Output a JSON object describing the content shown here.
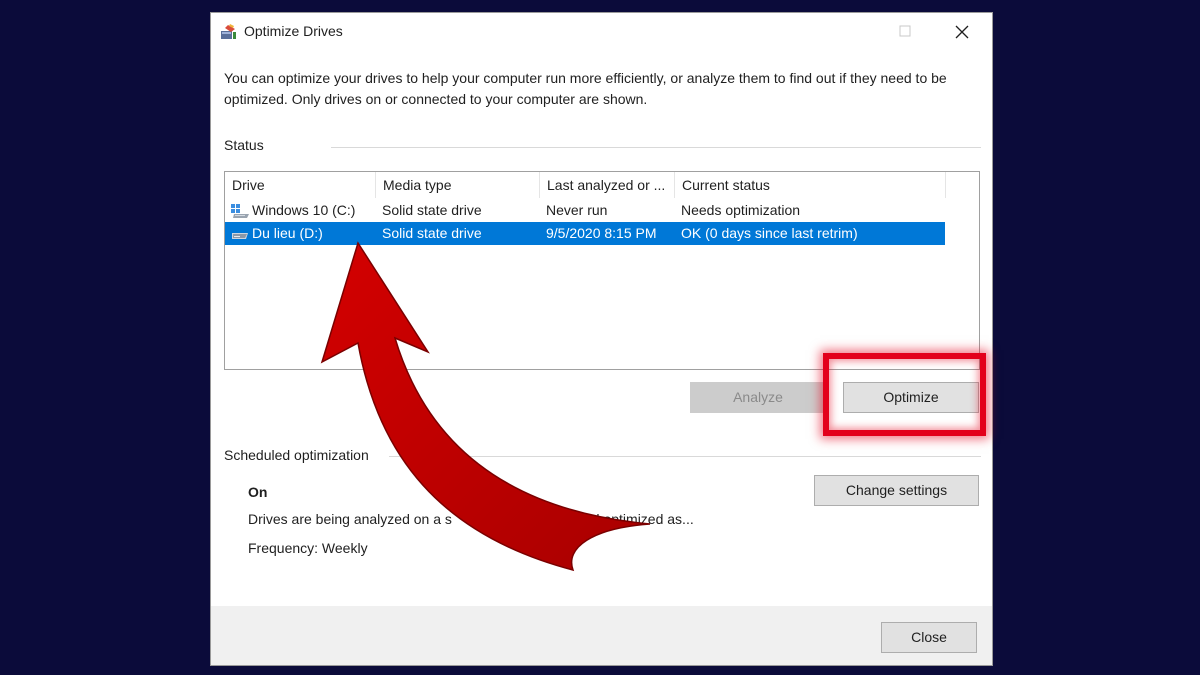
{
  "window": {
    "title": "Optimize Drives",
    "description": "You can optimize your drives to help your computer run more efficiently, or analyze them to find out if they need to be optimized. Only drives on or connected to your computer are shown."
  },
  "status": {
    "label": "Status",
    "columns": [
      "Drive",
      "Media type",
      "Last analyzed or ...",
      "Current status"
    ],
    "rows": [
      {
        "drive": "Windows 10 (C:)",
        "media": "Solid state drive",
        "last": "Never run",
        "status": "Needs optimization",
        "icon": "windows-drive-icon",
        "selected": false
      },
      {
        "drive": "Du lieu (D:)",
        "media": "Solid state drive",
        "last": "9/5/2020 8:15 PM",
        "status": "OK (0 days since last retrim)",
        "icon": "drive-icon",
        "selected": true
      }
    ]
  },
  "buttons": {
    "analyze": "Analyze",
    "optimize": "Optimize",
    "change_settings": "Change settings",
    "close": "Close"
  },
  "scheduled": {
    "label": "Scheduled optimization",
    "state": "On",
    "description_left": "Drives are being analyzed on a s",
    "description_right": "nd optimized as...",
    "frequency": "Frequency: Weekly"
  },
  "colors": {
    "selection": "#0078d7",
    "annotation_red": "#e3001b",
    "background": "#0b0b3a"
  }
}
